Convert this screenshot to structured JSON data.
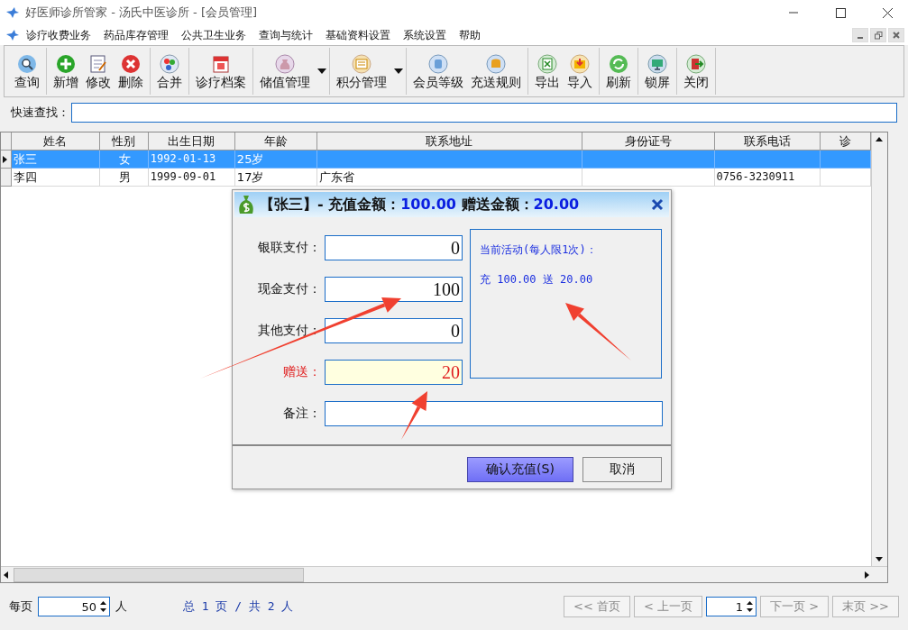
{
  "window": {
    "title": "好医师诊所管家 - 汤氏中医诊所 - [会员管理]"
  },
  "menu": [
    "诊疗收费业务",
    "药品库存管理",
    "公共卫生业务",
    "查询与统计",
    "基础资料设置",
    "系统设置",
    "帮助"
  ],
  "toolbar": [
    [
      {
        "label": "查询",
        "dropdown": false
      }
    ],
    [
      {
        "label": "新增",
        "dropdown": false
      },
      {
        "label": "修改",
        "dropdown": false
      },
      {
        "label": "删除",
        "dropdown": false
      }
    ],
    [
      {
        "label": "合并",
        "dropdown": false
      }
    ],
    [
      {
        "label": "诊疗档案",
        "dropdown": false
      }
    ],
    [
      {
        "label": "储值管理",
        "dropdown": true
      }
    ],
    [
      {
        "label": "积分管理",
        "dropdown": true
      }
    ],
    [
      {
        "label": "会员等级",
        "dropdown": false
      },
      {
        "label": "充送规则",
        "dropdown": false
      }
    ],
    [
      {
        "label": "导出",
        "dropdown": false
      },
      {
        "label": "导入",
        "dropdown": false
      }
    ],
    [
      {
        "label": "刷新",
        "dropdown": false
      }
    ],
    [
      {
        "label": "锁屏",
        "dropdown": false
      }
    ],
    [
      {
        "label": "关闭",
        "dropdown": false
      }
    ]
  ],
  "search": {
    "label": "快速查找："
  },
  "table": {
    "columns": [
      "姓名",
      "性别",
      "出生日期",
      "年龄",
      "联系地址",
      "身份证号",
      "联系电话",
      "诊"
    ],
    "rows": [
      {
        "selected": true,
        "cells": [
          "张三",
          "女",
          "1992-01-13",
          "25岁",
          "",
          "",
          "",
          ""
        ]
      },
      {
        "selected": false,
        "cells": [
          "李四",
          "男",
          "1999-09-01",
          "17岁",
          "广东省",
          "",
          "0756-3230911",
          ""
        ]
      }
    ]
  },
  "dialog": {
    "name": "【张三】- 充值金额：",
    "amount": "100.00",
    "bonus_label": "赠送金额：",
    "bonus": "20.00",
    "fields": [
      {
        "kind": "payment",
        "label": "银联支付：",
        "value": "0"
      },
      {
        "kind": "payment",
        "label": "现金支付：",
        "value": "100"
      },
      {
        "kind": "payment",
        "label": "其他支付：",
        "value": "0"
      },
      {
        "kind": "bonus",
        "label": "赠送：",
        "value": "20"
      },
      {
        "kind": "note",
        "label": "备注："
      }
    ],
    "activity": {
      "title": "当前活动(每人限1次)：",
      "rule": "充 100.00 送 20.00"
    },
    "buttons": [
      {
        "label": "确认充值(S)",
        "primary": true
      },
      {
        "label": "取消",
        "primary": false
      }
    ]
  },
  "footer": {
    "per_page_label": "每页",
    "per_page": "50",
    "unit": "人",
    "summary": "总 1 页 / 共 2 人",
    "page": "1",
    "nav": [
      {
        "label": "<< 首页",
        "disabled": true
      },
      {
        "label": "< 上一页",
        "disabled": true
      },
      {
        "label": "下一页 >",
        "disabled": true
      },
      {
        "label": "末页 >>",
        "disabled": true
      }
    ]
  }
}
